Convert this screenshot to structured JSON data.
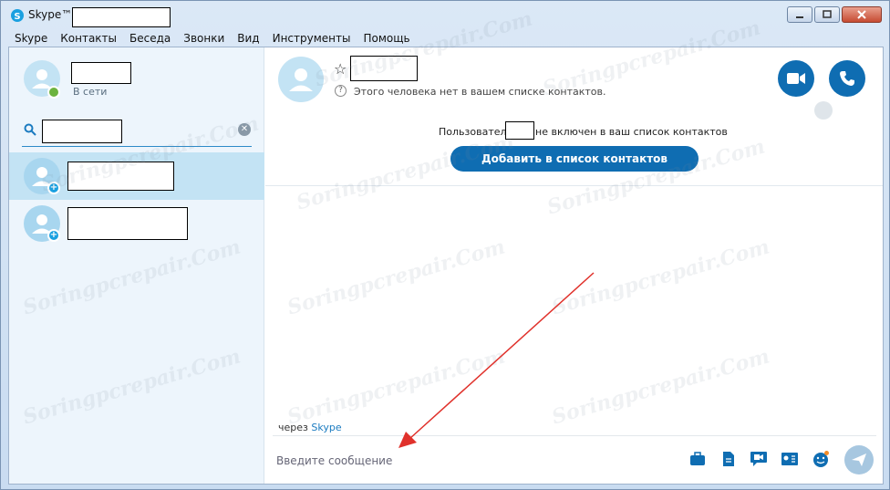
{
  "window": {
    "title": "Skype™ -"
  },
  "menu": [
    "Skype",
    "Контакты",
    "Беседа",
    "Звонки",
    "Вид",
    "Инструменты",
    "Помощь"
  ],
  "profile": {
    "status": "В сети"
  },
  "search": {
    "value": ""
  },
  "conversation": {
    "not_in_contacts_note": "Этого человека нет в вашем списке контактов.",
    "banner_prefix": "Пользователь",
    "banner_suffix": "не включен в ваш список контактов",
    "add_button": "Добавить в список контактов",
    "via_prefix": "через",
    "via_link": "Skype",
    "compose_placeholder": "Введите сообщение"
  },
  "watermark": "Soringpcrepair.Com",
  "colors": {
    "accent": "#0f6db2",
    "online": "#6cb33e",
    "annotation_arrow": "#e0312b"
  }
}
